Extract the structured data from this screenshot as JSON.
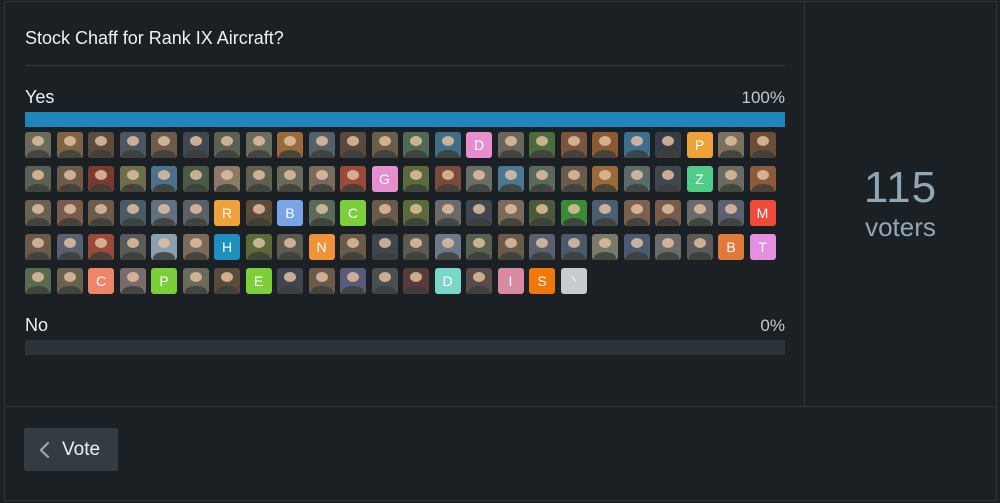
{
  "poll": {
    "question": "Stock Chaff for Rank IX Aircraft?",
    "options": [
      {
        "label": "Yes",
        "percent_label": "100%",
        "fraction": 1.0
      },
      {
        "label": "No",
        "percent_label": "0%",
        "fraction": 0.0
      }
    ],
    "voter_count": "115",
    "voter_count_label": "voters",
    "vote_button": "Vote",
    "accent_color": "#1e86b8"
  },
  "voters": [
    {
      "t": "img",
      "c": "#6c6a5a"
    },
    {
      "t": "img",
      "c": "#7d6444"
    },
    {
      "t": "img",
      "c": "#5d4b3c"
    },
    {
      "t": "img",
      "c": "#4c5560"
    },
    {
      "t": "img",
      "c": "#6e5a48"
    },
    {
      "t": "img",
      "c": "#3f4750"
    },
    {
      "t": "img",
      "c": "#5a6152"
    },
    {
      "t": "img",
      "c": "#6b6d5c"
    },
    {
      "t": "img",
      "c": "#9a6a3a"
    },
    {
      "t": "img",
      "c": "#556069"
    },
    {
      "t": "img",
      "c": "#5a4a3e"
    },
    {
      "t": "img",
      "c": "#6a5d4a"
    },
    {
      "t": "img",
      "c": "#4e6a52"
    },
    {
      "t": "img",
      "c": "#3e6f86"
    },
    {
      "t": "letter",
      "l": "D",
      "c": "#e58fcf"
    },
    {
      "t": "img",
      "c": "#6a665e"
    },
    {
      "t": "img",
      "c": "#4b6b3a"
    },
    {
      "t": "img",
      "c": "#7a5540"
    },
    {
      "t": "img",
      "c": "#8a5a35"
    },
    {
      "t": "img",
      "c": "#3d6f8d"
    },
    {
      "t": "img",
      "c": "#353d47"
    },
    {
      "t": "letter",
      "l": "P",
      "c": "#f0a23a"
    },
    {
      "t": "img",
      "c": "#7a7060"
    },
    {
      "t": "img",
      "c": "#6a4d35"
    },
    {
      "t": "img",
      "c": "#5c5f55"
    },
    {
      "t": "img",
      "c": "#6e5a48"
    },
    {
      "t": "img",
      "c": "#7a3a30"
    },
    {
      "t": "img",
      "c": "#6b6d4c"
    },
    {
      "t": "img",
      "c": "#4e7088"
    },
    {
      "t": "img",
      "c": "#4a5a48"
    },
    {
      "t": "img",
      "c": "#8a7a66"
    },
    {
      "t": "img",
      "c": "#5e6150"
    },
    {
      "t": "img",
      "c": "#6a6a5a"
    },
    {
      "t": "img",
      "c": "#7a6a5a"
    },
    {
      "t": "img",
      "c": "#9a4a3a"
    },
    {
      "t": "letter",
      "l": "G",
      "c": "#e58fcf"
    },
    {
      "t": "img",
      "c": "#5a6a3a"
    },
    {
      "t": "img",
      "c": "#7a4a3a"
    },
    {
      "t": "img",
      "c": "#6a6d66"
    },
    {
      "t": "img",
      "c": "#4a7890"
    },
    {
      "t": "img",
      "c": "#5a6a5a"
    },
    {
      "t": "img",
      "c": "#6a5a4a"
    },
    {
      "t": "img",
      "c": "#9a6a3a"
    },
    {
      "t": "img",
      "c": "#5a6a6a"
    },
    {
      "t": "img",
      "c": "#3e4650"
    },
    {
      "t": "letter",
      "l": "Z",
      "c": "#4fce8a"
    },
    {
      "t": "img",
      "c": "#6a6a60"
    },
    {
      "t": "img",
      "c": "#8a5a3a"
    },
    {
      "t": "img",
      "c": "#6a6050"
    },
    {
      "t": "img",
      "c": "#7a5a4a"
    },
    {
      "t": "img",
      "c": "#6e5a4a"
    },
    {
      "t": "img",
      "c": "#4a5a66"
    },
    {
      "t": "img",
      "c": "#607080"
    },
    {
      "t": "img",
      "c": "#5a6066"
    },
    {
      "t": "letter",
      "l": "R",
      "c": "#f0a23a"
    },
    {
      "t": "img",
      "c": "#5a4a3a"
    },
    {
      "t": "letter",
      "l": "B",
      "c": "#7aa4e8"
    },
    {
      "t": "img",
      "c": "#5a6a5a"
    },
    {
      "t": "letter",
      "l": "C",
      "c": "#7ccf3a"
    },
    {
      "t": "img",
      "c": "#6a5a4a"
    },
    {
      "t": "img",
      "c": "#5a6a3a"
    },
    {
      "t": "img",
      "c": "#6a6a6a"
    },
    {
      "t": "img",
      "c": "#3e4650"
    },
    {
      "t": "img",
      "c": "#7a6a5a"
    },
    {
      "t": "img",
      "c": "#4a5a3a"
    },
    {
      "t": "img",
      "c": "#3a8a3a"
    },
    {
      "t": "img",
      "c": "#4a6070"
    },
    {
      "t": "img",
      "c": "#7a6050"
    },
    {
      "t": "img",
      "c": "#7a5a4a"
    },
    {
      "t": "img",
      "c": "#6a6a6a"
    },
    {
      "t": "img",
      "c": "#5a6070"
    },
    {
      "t": "letter",
      "l": "M",
      "c": "#f04a3a"
    },
    {
      "t": "img",
      "c": "#6a5a4a"
    },
    {
      "t": "img",
      "c": "#5a6070"
    },
    {
      "t": "img",
      "c": "#9a4a3a"
    },
    {
      "t": "img",
      "c": "#5a5a5a"
    },
    {
      "t": "img",
      "c": "#8aa0b0"
    },
    {
      "t": "img",
      "c": "#7a6a5a"
    },
    {
      "t": "letter",
      "l": "H",
      "c": "#1e90c0"
    },
    {
      "t": "img",
      "c": "#5a6a3a"
    },
    {
      "t": "img",
      "c": "#5a5a50"
    },
    {
      "t": "letter",
      "l": "N",
      "c": "#f0923a"
    },
    {
      "t": "img",
      "c": "#6a5a4a"
    },
    {
      "t": "img",
      "c": "#3e4650"
    },
    {
      "t": "img",
      "c": "#5a5a50"
    },
    {
      "t": "img",
      "c": "#6a7a8a"
    },
    {
      "t": "img",
      "c": "#5a6050"
    },
    {
      "t": "img",
      "c": "#6a5a4a"
    },
    {
      "t": "img",
      "c": "#5a6070"
    },
    {
      "t": "img",
      "c": "#4a5a6a"
    },
    {
      "t": "img",
      "c": "#7a7a6a"
    },
    {
      "t": "img",
      "c": "#4a5a70"
    },
    {
      "t": "img",
      "c": "#6a6a6a"
    },
    {
      "t": "img",
      "c": "#5a5a5a"
    },
    {
      "t": "letter",
      "l": "B",
      "c": "#e07a3a"
    },
    {
      "t": "letter",
      "l": "T",
      "c": "#e58fe0"
    },
    {
      "t": "img",
      "c": "#5a6a50"
    },
    {
      "t": "img",
      "c": "#6a6050"
    },
    {
      "t": "letter",
      "l": "C",
      "c": "#f0846a"
    },
    {
      "t": "img",
      "c": "#7a6a6a"
    },
    {
      "t": "letter",
      "l": "P",
      "c": "#7ccf3a"
    },
    {
      "t": "img",
      "c": "#6a6a5a"
    },
    {
      "t": "img",
      "c": "#5a4a3a"
    },
    {
      "t": "letter",
      "l": "E",
      "c": "#7ccf3a"
    },
    {
      "t": "img",
      "c": "#3e4650"
    },
    {
      "t": "img",
      "c": "#6a5a4a"
    },
    {
      "t": "img",
      "c": "#5a5a7a"
    },
    {
      "t": "img",
      "c": "#4a5050"
    },
    {
      "t": "img",
      "c": "#5a3a3a"
    },
    {
      "t": "letter",
      "l": "D",
      "c": "#7ad6c8"
    },
    {
      "t": "img",
      "c": "#5a4a4a"
    },
    {
      "t": "letter",
      "l": "I",
      "c": "#d88aa0"
    },
    {
      "t": "letter",
      "l": "S",
      "c": "#f0780a"
    },
    {
      "t": "letter",
      "l": "⸌",
      "c": "#c8ccd0"
    }
  ]
}
